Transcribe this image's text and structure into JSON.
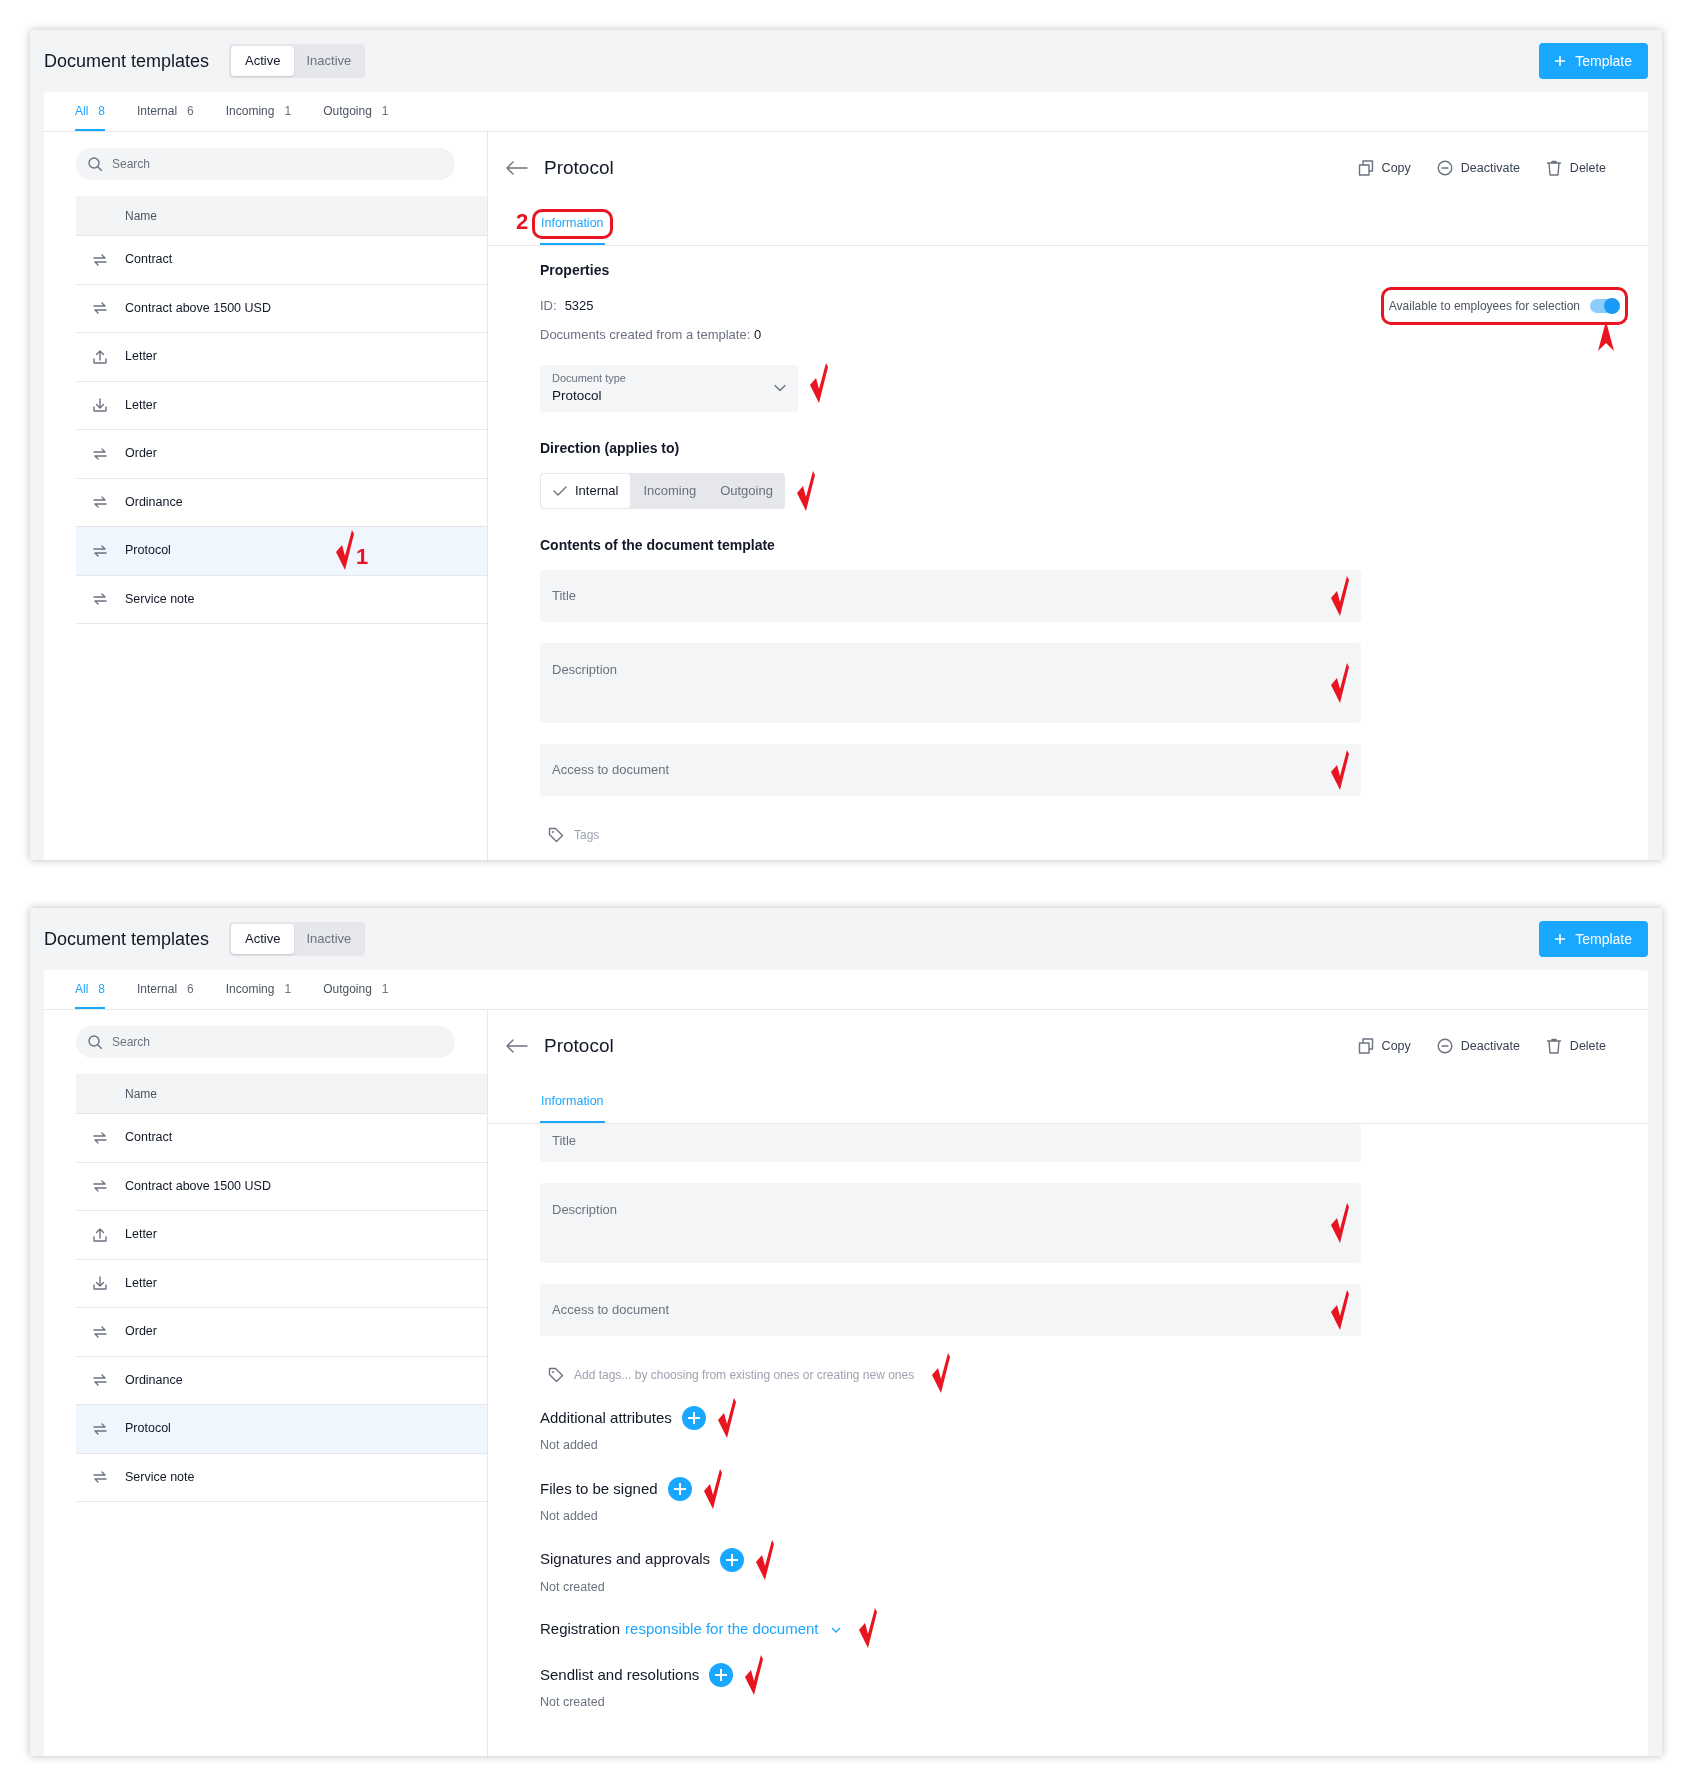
{
  "screens": [
    {
      "title": "Document templates",
      "status_tabs": [
        {
          "label": "Active",
          "selected": true
        },
        {
          "label": "Inactive",
          "selected": false
        }
      ],
      "new_button": "Template",
      "filters": [
        {
          "label": "All",
          "count": "8",
          "selected": true
        },
        {
          "label": "Internal",
          "count": "6",
          "selected": false
        },
        {
          "label": "Incoming",
          "count": "1",
          "selected": false
        },
        {
          "label": "Outgoing",
          "count": "1",
          "selected": false
        }
      ],
      "search": {
        "placeholder": "Search"
      },
      "column": "Name",
      "rows": [
        {
          "label": "Contract",
          "kind": "exchange",
          "selected": false
        },
        {
          "label": "Contract above 1500 USD",
          "kind": "exchange",
          "selected": false
        },
        {
          "label": "Letter",
          "kind": "upload",
          "selected": false
        },
        {
          "label": "Letter",
          "kind": "download",
          "selected": false
        },
        {
          "label": "Order",
          "kind": "exchange",
          "selected": false
        },
        {
          "label": "Ordinance",
          "kind": "exchange",
          "selected": false
        },
        {
          "label": "Protocol",
          "kind": "exchange",
          "selected": true,
          "annotation": "1"
        },
        {
          "label": "Service note",
          "kind": "exchange",
          "selected": false
        }
      ],
      "detail": {
        "title": "Protocol",
        "actions": [
          {
            "label": "Copy",
            "kind": "copy"
          },
          {
            "label": "Deactivate",
            "kind": "deactivate"
          },
          {
            "label": "Delete",
            "kind": "delete"
          }
        ],
        "tabs": [
          {
            "label": "Information",
            "selected": true,
            "annotation": "2"
          }
        ],
        "content": [
          {
            "kind": "heading",
            "text": "Properties",
            "annotated": false
          },
          {
            "kind": "id",
            "label": "ID:",
            "value": "5325",
            "toggle_label": "Available to employees for selection",
            "on": true,
            "callout": true,
            "annotated": false
          },
          {
            "kind": "stat",
            "label": "Documents created from a template:",
            "value": "0",
            "annotated": false
          },
          {
            "kind": "select",
            "label": "Document type",
            "value": "Protocol",
            "annotated": true
          },
          {
            "kind": "heading",
            "text": "Direction (applies to)",
            "annotated": false
          },
          {
            "kind": "segmented",
            "options": [
              {
                "label": "Internal",
                "selected": true
              },
              {
                "label": "Incoming",
                "selected": false
              },
              {
                "label": "Outgoing",
                "selected": false
              }
            ],
            "annotated": true
          },
          {
            "kind": "heading",
            "text": "Contents of the document template",
            "annotated": false
          },
          {
            "kind": "field",
            "placeholder": "Title",
            "annotated": true
          },
          {
            "kind": "textarea",
            "placeholder": "Description",
            "annotated": true
          },
          {
            "kind": "field",
            "placeholder": "Access to document",
            "annotated": true
          },
          {
            "kind": "tags",
            "text": "Tags",
            "annotated": false
          }
        ]
      }
    },
    {
      "title": "Document templates",
      "status_tabs": [
        {
          "label": "Active",
          "selected": true
        },
        {
          "label": "Inactive",
          "selected": false
        }
      ],
      "new_button": "Template",
      "filters": [
        {
          "label": "All",
          "count": "8",
          "selected": true
        },
        {
          "label": "Internal",
          "count": "6",
          "selected": false
        },
        {
          "label": "Incoming",
          "count": "1",
          "selected": false
        },
        {
          "label": "Outgoing",
          "count": "1",
          "selected": false
        }
      ],
      "search": {
        "placeholder": "Search"
      },
      "column": "Name",
      "rows": [
        {
          "label": "Contract",
          "kind": "exchange",
          "selected": false
        },
        {
          "label": "Contract above 1500 USD",
          "kind": "exchange",
          "selected": false
        },
        {
          "label": "Letter",
          "kind": "upload",
          "selected": false
        },
        {
          "label": "Letter",
          "kind": "download",
          "selected": false
        },
        {
          "label": "Order",
          "kind": "exchange",
          "selected": false
        },
        {
          "label": "Ordinance",
          "kind": "exchange",
          "selected": false
        },
        {
          "label": "Protocol",
          "kind": "exchange",
          "selected": true
        },
        {
          "label": "Service note",
          "kind": "exchange",
          "selected": false
        }
      ],
      "detail": {
        "title": "Protocol",
        "actions": [
          {
            "label": "Copy",
            "kind": "copy"
          },
          {
            "label": "Deactivate",
            "kind": "deactivate"
          },
          {
            "label": "Delete",
            "kind": "delete"
          }
        ],
        "tabs": [
          {
            "label": "Information",
            "selected": true
          }
        ],
        "content": [
          {
            "kind": "field",
            "placeholder": "Title",
            "annotated": false
          },
          {
            "kind": "textarea",
            "placeholder": "Description",
            "annotated": true
          },
          {
            "kind": "field",
            "placeholder": "Access to document",
            "annotated": true
          },
          {
            "kind": "tags",
            "text": "Add tags... by choosing from existing ones or creating new ones",
            "annotated": true
          },
          {
            "kind": "section",
            "title": "Additional attributes",
            "note": "Not added",
            "add": true,
            "annotated": true
          },
          {
            "kind": "section",
            "title": "Files to be signed",
            "note": "Not added",
            "add": true,
            "annotated": true
          },
          {
            "kind": "section",
            "title": "Signatures and approvals",
            "note": "Not created",
            "add": true,
            "annotated": true
          },
          {
            "kind": "registration",
            "title": "Registration",
            "link": "responsible for the document",
            "annotated": true
          },
          {
            "kind": "section",
            "title": "Sendlist and resolutions",
            "note": "Not created",
            "add": true,
            "annotated": true
          }
        ]
      }
    }
  ]
}
